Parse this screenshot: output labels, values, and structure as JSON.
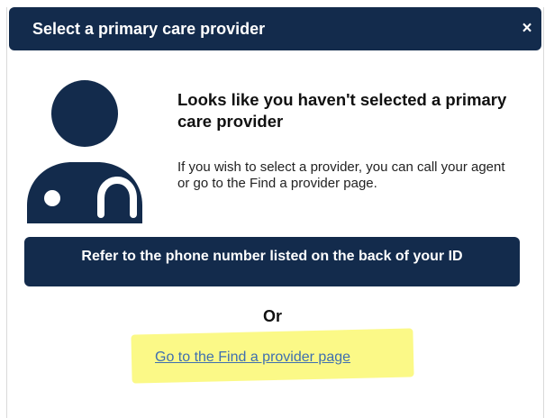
{
  "modal": {
    "title": "Select a primary care provider",
    "close_symbol": "×"
  },
  "icons": {
    "doctor": "doctor-icon",
    "close": "close-icon"
  },
  "notice": {
    "heading": "Looks like you haven't selected a primary care provider",
    "body": "If you wish to select a provider, you can call your agent or go to the Find a provider page."
  },
  "actions": {
    "phone_button_label": "Refer to the phone number listed on the back of your ID",
    "or_separator": "Or",
    "find_link_label": "Go to the Find a provider page"
  },
  "colors": {
    "primary": "#132b4c",
    "link": "#3f6fb0",
    "highlight": "#fbf87a"
  }
}
